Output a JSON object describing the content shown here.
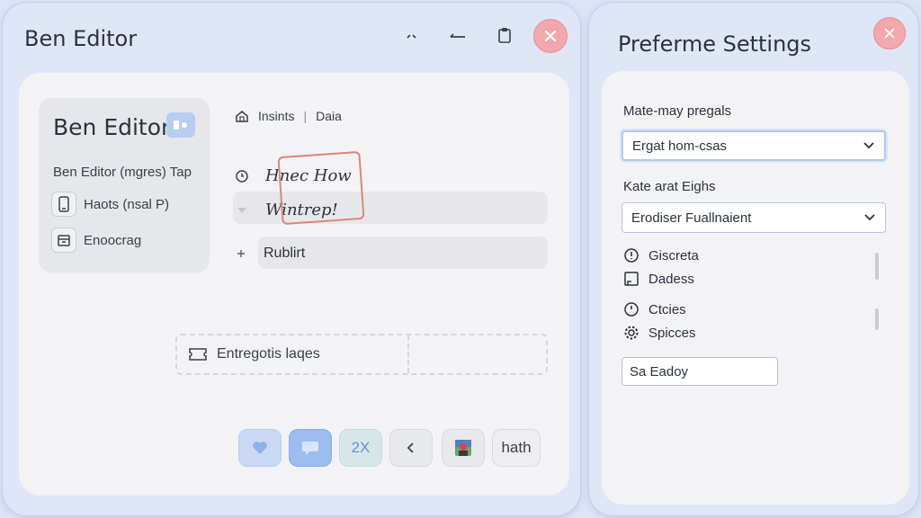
{
  "editor": {
    "window_title": "Ben Editor",
    "card": {
      "title": "Ben Editor",
      "subtitle": "Ben Editor (mgres) Tap",
      "items": [
        {
          "label": "Haots (nsal P)",
          "icon": "phone-icon"
        },
        {
          "label": "Enoocrag",
          "icon": "calendar-icon"
        }
      ]
    },
    "breadcrumb": {
      "home_label": "Insints",
      "separator": "|",
      "current": "Daia"
    },
    "rows": [
      {
        "text": "Hnec How",
        "icon": "clock-icon"
      },
      {
        "text": "Wintrep!",
        "icon": "triangle-down-icon"
      },
      {
        "text": "Rublirt",
        "icon": "plus-icon"
      }
    ],
    "drop_zone_label": "Entregotis laqes",
    "toolbar": [
      {
        "label": "",
        "icon": "heart-icon",
        "color": "#c9d8f3"
      },
      {
        "label": "",
        "icon": "speech-bubble-icon",
        "color": "#9dbcf0"
      },
      {
        "label": "2X",
        "icon": "",
        "color": "#d6e7ea"
      },
      {
        "label": "",
        "icon": "arrow-left-icon",
        "color": "#e8e9ec"
      },
      {
        "label": "",
        "icon": "image-icon",
        "color": "#e8e9ec"
      },
      {
        "label": "hath",
        "icon": "",
        "color": "#eeeef0"
      }
    ]
  },
  "settings": {
    "window_title": "Preferme Settings",
    "field1_label": "Mate-may pregals",
    "field1_value": "Ergat hom-csas",
    "field2_label": "Kate arat Eighs",
    "field2_value": "Erodiser Fuallnaient",
    "options": [
      {
        "label": "Giscreta",
        "icon": "info-circle-icon"
      },
      {
        "label": "Dadess",
        "icon": "square-icon"
      },
      {
        "label": "Ctcies",
        "icon": "clock-icon"
      },
      {
        "label": "Spicces",
        "icon": "gear-icon"
      }
    ],
    "input_value": "Sa Eadoy"
  }
}
